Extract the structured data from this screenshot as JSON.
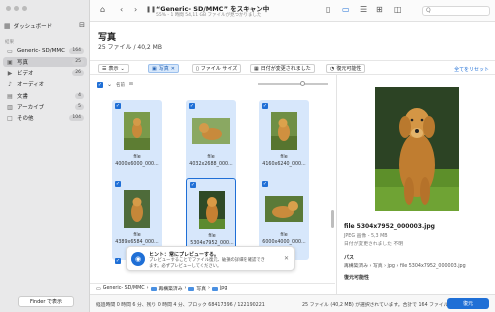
{
  "app": {
    "title": "“Generic- SD/MMC” をスキャン中",
    "subtitle": "55% - 1 時間 54,11 GB ファイルが見つかりました",
    "search_placeholder": "Q"
  },
  "sidebar": {
    "dashboard": "ダッシュボード",
    "section": "結果",
    "items": [
      {
        "label": "Generic- SD/MMC",
        "count": "164"
      },
      {
        "label": "写真",
        "count": "25"
      },
      {
        "label": "ビデオ",
        "count": "26"
      },
      {
        "label": "オーディオ",
        "count": ""
      },
      {
        "label": "文書",
        "count": "4"
      },
      {
        "label": "アーカイブ",
        "count": "5"
      },
      {
        "label": "その他",
        "count": "104"
      }
    ],
    "finder_button": "Finder で表示"
  },
  "header": {
    "title": "写真",
    "subtitle": "25 ファイル / 40,2 MB"
  },
  "filters": {
    "view": "表示",
    "photos": "写真",
    "filesize": "ファイル サイズ",
    "date_changed": "日付が変更されました",
    "recoverability": "復元可能性",
    "reset": "全てをリセット"
  },
  "grid_header": {
    "name": "名前"
  },
  "tiles": [
    {
      "name": "file",
      "sub": "4000x6000_000..."
    },
    {
      "name": "file",
      "sub": "4032x2688_000..."
    },
    {
      "name": "file",
      "sub": "4160x6240_000..."
    },
    {
      "name": "file",
      "sub": "4389x6584_000..."
    },
    {
      "name": "file",
      "sub": "5304x7952_000..."
    },
    {
      "name": "file",
      "sub": "6000x4000_000..."
    }
  ],
  "tooltip": {
    "title": "ヒント：常にプレビューする。",
    "body": "プレビューすることでファイル復元、破損の詳細を確認できます。必ずプレビューしてください。"
  },
  "breadcrumb": [
    "Generic- SD/MMC",
    "再構築済み",
    "写真",
    "jpg"
  ],
  "status": {
    "left": "経過時間 0 時間 6 分、残り 0 時間 4 分、ブロック 68417396 / 122190221",
    "right": "25 ファイル (40,2 MB) が選択されています。合計で 164 ファイル数",
    "recover": "復元"
  },
  "preview": {
    "filename": "file 5304x7952_000003.jpg",
    "meta": "JPEG 画像 - 5,3 MB",
    "meta2": "日付が変更されました 不明",
    "path_label": "パス",
    "path_value": "再構築済み › 写真 › jpg › file 5304x7952_000003.jpg",
    "recover_label": "復元可能性"
  },
  "colors": {
    "accent": "#1f6fd6",
    "selected_tile": "#d7e7fb"
  }
}
